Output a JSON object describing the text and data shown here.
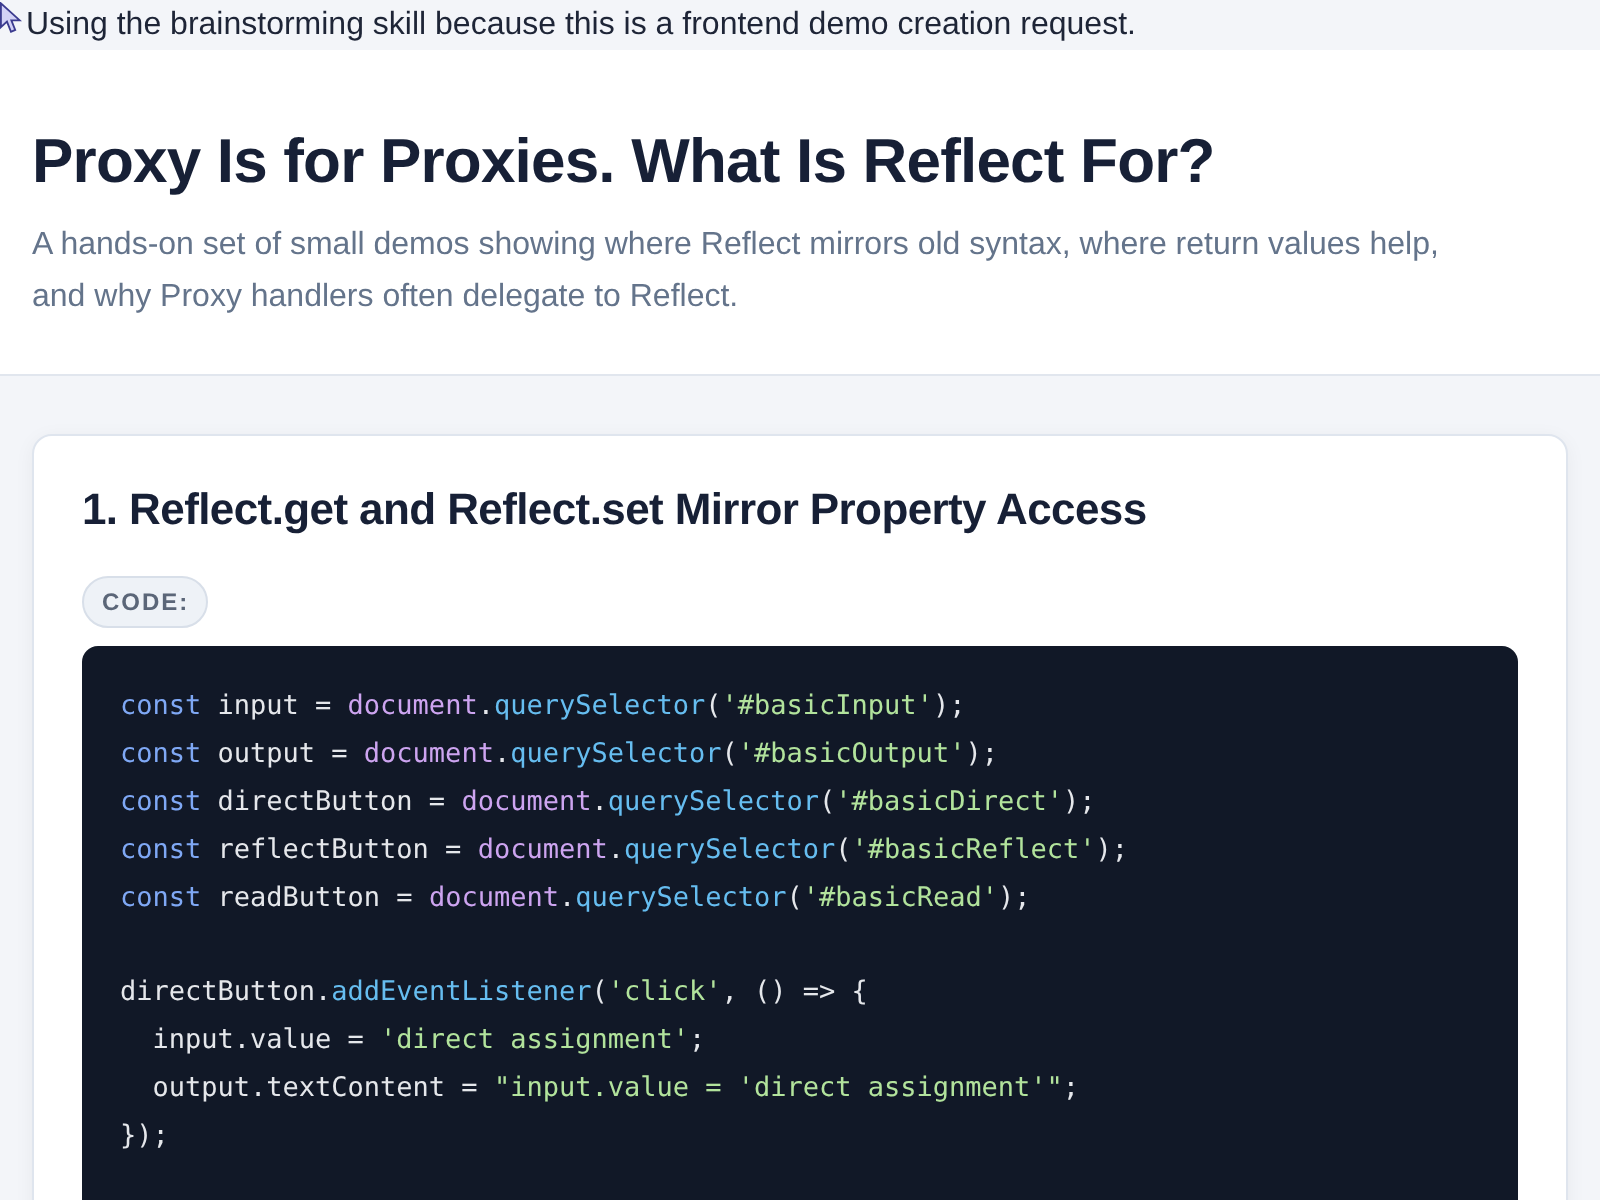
{
  "notice": {
    "text": "Using the brainstorming skill because this is a frontend demo creation request."
  },
  "header": {
    "title": "Proxy Is for Proxies. What Is Reflect For?",
    "subtitle": "A hands-on set of small demos showing where Reflect mirrors old syntax, where return values help, and why Proxy handlers often delegate to Reflect."
  },
  "sections": [
    {
      "title": "1. Reflect.get and Reflect.set Mirror Property Access",
      "badge": "CODE:",
      "code_lines": [
        {
          "kind": "code",
          "tokens": [
            {
              "kind": "keyword",
              "text": "const"
            },
            {
              "kind": "plain",
              "text": " input = "
            },
            {
              "kind": "builtin",
              "text": "document"
            },
            {
              "kind": "plain",
              "text": "."
            },
            {
              "kind": "method",
              "text": "querySelector"
            },
            {
              "kind": "plain",
              "text": "("
            },
            {
              "kind": "string",
              "text": "'#basicInput'"
            },
            {
              "kind": "plain",
              "text": ");"
            }
          ]
        },
        {
          "kind": "code",
          "tokens": [
            {
              "kind": "keyword",
              "text": "const"
            },
            {
              "kind": "plain",
              "text": " output = "
            },
            {
              "kind": "builtin",
              "text": "document"
            },
            {
              "kind": "plain",
              "text": "."
            },
            {
              "kind": "method",
              "text": "querySelector"
            },
            {
              "kind": "plain",
              "text": "("
            },
            {
              "kind": "string",
              "text": "'#basicOutput'"
            },
            {
              "kind": "plain",
              "text": ");"
            }
          ]
        },
        {
          "kind": "code",
          "tokens": [
            {
              "kind": "keyword",
              "text": "const"
            },
            {
              "kind": "plain",
              "text": " directButton = "
            },
            {
              "kind": "builtin",
              "text": "document"
            },
            {
              "kind": "plain",
              "text": "."
            },
            {
              "kind": "method",
              "text": "querySelector"
            },
            {
              "kind": "plain",
              "text": "("
            },
            {
              "kind": "string",
              "text": "'#basicDirect'"
            },
            {
              "kind": "plain",
              "text": ");"
            }
          ]
        },
        {
          "kind": "code",
          "tokens": [
            {
              "kind": "keyword",
              "text": "const"
            },
            {
              "kind": "plain",
              "text": " reflectButton = "
            },
            {
              "kind": "builtin",
              "text": "document"
            },
            {
              "kind": "plain",
              "text": "."
            },
            {
              "kind": "method",
              "text": "querySelector"
            },
            {
              "kind": "plain",
              "text": "("
            },
            {
              "kind": "string",
              "text": "'#basicReflect'"
            },
            {
              "kind": "plain",
              "text": ");"
            }
          ]
        },
        {
          "kind": "code",
          "tokens": [
            {
              "kind": "keyword",
              "text": "const"
            },
            {
              "kind": "plain",
              "text": " readButton = "
            },
            {
              "kind": "builtin",
              "text": "document"
            },
            {
              "kind": "plain",
              "text": "."
            },
            {
              "kind": "method",
              "text": "querySelector"
            },
            {
              "kind": "plain",
              "text": "("
            },
            {
              "kind": "string",
              "text": "'#basicRead'"
            },
            {
              "kind": "plain",
              "text": ");"
            }
          ]
        },
        {
          "kind": "blank"
        },
        {
          "kind": "code",
          "tokens": [
            {
              "kind": "plain",
              "text": "directButton."
            },
            {
              "kind": "method",
              "text": "addEventListener"
            },
            {
              "kind": "plain",
              "text": "("
            },
            {
              "kind": "string",
              "text": "'click'"
            },
            {
              "kind": "plain",
              "text": ", () => {"
            }
          ]
        },
        {
          "kind": "code",
          "tokens": [
            {
              "kind": "plain",
              "text": "  input.value = "
            },
            {
              "kind": "string",
              "text": "'direct assignment'"
            },
            {
              "kind": "plain",
              "text": ";"
            }
          ]
        },
        {
          "kind": "code",
          "tokens": [
            {
              "kind": "plain",
              "text": "  output.textContent = "
            },
            {
              "kind": "string",
              "text": "\"input.value = 'direct assignment'\""
            },
            {
              "kind": "plain",
              "text": ";"
            }
          ]
        },
        {
          "kind": "code",
          "tokens": [
            {
              "kind": "plain",
              "text": "});"
            }
          ]
        }
      ]
    }
  ]
}
